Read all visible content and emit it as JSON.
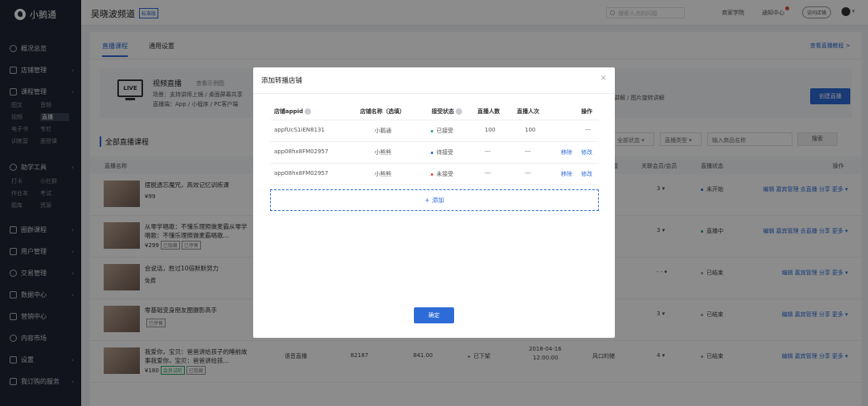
{
  "sidebar": {
    "logo": "小鹅通",
    "items": [
      {
        "label": "概况总览",
        "has_chevron": false
      },
      {
        "label": "店铺管理",
        "has_chevron": true
      },
      {
        "label": "课程管理",
        "has_chevron": true
      },
      {
        "label": "助学工具",
        "has_chevron": true
      },
      {
        "label": "圈群课程",
        "has_chevron": true
      },
      {
        "label": "用户管理",
        "has_chevron": true
      },
      {
        "label": "交易管理",
        "has_chevron": true
      },
      {
        "label": "数据中心",
        "has_chevron": true
      },
      {
        "label": "营销中心",
        "has_chevron": false
      },
      {
        "label": "内容市场",
        "has_chevron": false
      },
      {
        "label": "设置",
        "has_chevron": true
      },
      {
        "label": "我订购的服务",
        "has_chevron": true
      }
    ],
    "course_sub": [
      "图文",
      "音频",
      "视频",
      "直播",
      "电子书",
      "专栏",
      "训练营",
      "面授课"
    ],
    "tools_sub": [
      "打卡",
      "小社群",
      "作业本",
      "考试",
      "题库",
      "资源"
    ]
  },
  "header": {
    "title": "吴晓波频道",
    "badge": "标准版",
    "search_placeholder": "搜索人点的问题",
    "links": [
      "商家学院",
      "通知中心"
    ],
    "shop_button": "访问店铺"
  },
  "main": {
    "tabs": [
      "直播课程",
      "通用设置"
    ],
    "tutorial_link": "查看直播教程 >",
    "intro": {
      "icon_text": "LIVE",
      "title": "视频直播",
      "example": "查看示例图",
      "scene": "场景：支持讲师上镜 / 桌面屏幕共享",
      "platform": "直播端：App / 小程序 / PC客户端",
      "extra": "语音讲解 / 图片旋转讲解",
      "create_button": "创建直播"
    },
    "section_title": "全部直播课程",
    "filters": {
      "status": "全部状态",
      "type": "直播类型",
      "search_placeholder": "输入商品名称",
      "search_button": "搜索"
    },
    "table_headers": [
      "直播名称",
      "程",
      "关联会员/会员",
      "直播状态",
      "操作"
    ],
    "rows": [
      {
        "title": "摆脱遗忘魔咒，高效记忆训练课",
        "price": "¥99",
        "tags": [],
        "c1": "猪",
        "members": "3",
        "status": "未开始",
        "status_color": "#2d6bd8",
        "ops": "编辑  嘉宾管理  去直播  分享  更多"
      },
      {
        "title": "从零学唱歌：不懂乐理照做麦霸从零学唱歌：不懂乐理照做麦霸唱歌...",
        "price": "¥299",
        "tags": [
          {
            "t": "已隐藏",
            "c": "gray"
          },
          {
            "t": "已停售",
            "c": "gray"
          }
        ],
        "c1": "猪",
        "members": "3",
        "status": "直播中",
        "status_color": "#2aa86a",
        "ops": "编辑  嘉宾管理  去直播  分享  更多"
      },
      {
        "title": "会说话，胜过10倍默默努力",
        "price": "免费",
        "tags": [],
        "c1": "猪",
        "members": "- -",
        "status": "已结束",
        "status_color": "#999999",
        "ops": "编辑  嘉宾管理  分享  更多"
      },
      {
        "title": "零基础变身朋友圈摄影高手",
        "price": "",
        "tags": [
          {
            "t": "已停售",
            "c": "gray"
          }
        ],
        "c1": "猪",
        "members": "3",
        "status": "已结束",
        "status_color": "#999999",
        "ops": "编辑  嘉宾管理  分享  更多"
      },
      {
        "title": "我爱你，宝贝：爸爸讲给孩子的睡前故事我爱你，宝贝：爸爸讲给孩...",
        "price": "¥180",
        "tags": [
          {
            "t": "会员试听",
            "c": "green"
          },
          {
            "t": "已隐藏",
            "c": "gray"
          }
        ],
        "c1": "风口的猪",
        "members": "4",
        "status": "已结束",
        "status_color": "#999999",
        "ops": "编辑  嘉宾管理  分享  更多",
        "type": "语音直播",
        "count": "82187",
        "revenue": "841.00",
        "sale": "已下架",
        "date": "2018-04-16",
        "time": "12:00:00"
      }
    ]
  },
  "modal": {
    "title": "添加转播店铺",
    "headers": [
      "店铺appid",
      "店铺名称（选填）",
      "接受状态",
      "直播人数",
      "直播人次",
      "操作"
    ],
    "rows": [
      {
        "appid": "appfUcS1iEN8131",
        "name": "小鹅通",
        "status": "已接受",
        "status_color": "#2aa86a",
        "viewers": "100",
        "views": "100",
        "op1": "",
        "op2": "---"
      },
      {
        "appid": "app08hx8FM02957",
        "name": "小熊熊",
        "status": "待接受",
        "status_color": "#2d6bd8",
        "viewers": "---",
        "views": "---",
        "op1": "移除",
        "op2": "修改"
      },
      {
        "appid": "app08hx8FM02957",
        "name": "小熊熊",
        "status": "未接受",
        "status_color": "#e5453a",
        "viewers": "---",
        "views": "---",
        "op1": "移除",
        "op2": "修改"
      }
    ],
    "add_label": "添加",
    "confirm": "确定"
  }
}
